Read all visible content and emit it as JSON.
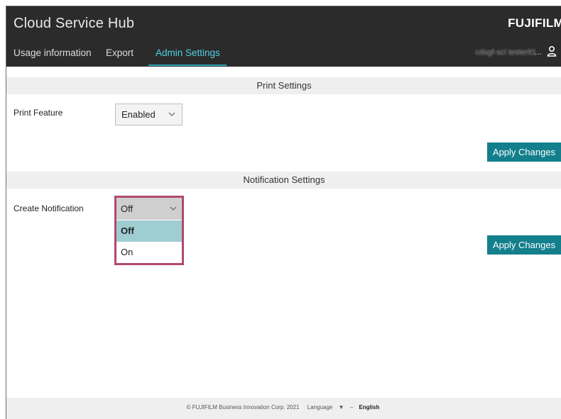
{
  "header": {
    "app_title": "Cloud Service Hub",
    "logo": "FUJIFILM",
    "nav": [
      {
        "label": "Usage information",
        "active": false
      },
      {
        "label": "Export",
        "active": false
      },
      {
        "label": "Admin Settings",
        "active": true
      }
    ],
    "user": {
      "name": "cdsgf-scl testerlt1",
      "ellipsis": "...",
      "icon": "user-icon"
    }
  },
  "print_settings": {
    "section_title": "Print Settings",
    "field_label": "Print Feature",
    "value": "Enabled",
    "apply_label": "Apply Changes"
  },
  "notification_settings": {
    "section_title": "Notification Settings",
    "field_label": "Create Notification",
    "value": "Off",
    "options": [
      "Off",
      "On"
    ],
    "selected_option": "Off",
    "apply_label": "Apply Changes"
  },
  "footer": {
    "copyright": "© FUJIFILM Business Innovation Corp. 2021",
    "language_label": "Language",
    "separator": "–",
    "language_value": "English"
  },
  "colors": {
    "header_bg": "#2b2b2b",
    "accent": "#4fd1e0",
    "button": "#137f8c",
    "dropdown_highlight": "#9ecdd2",
    "focus_border": "#b04a6e"
  }
}
